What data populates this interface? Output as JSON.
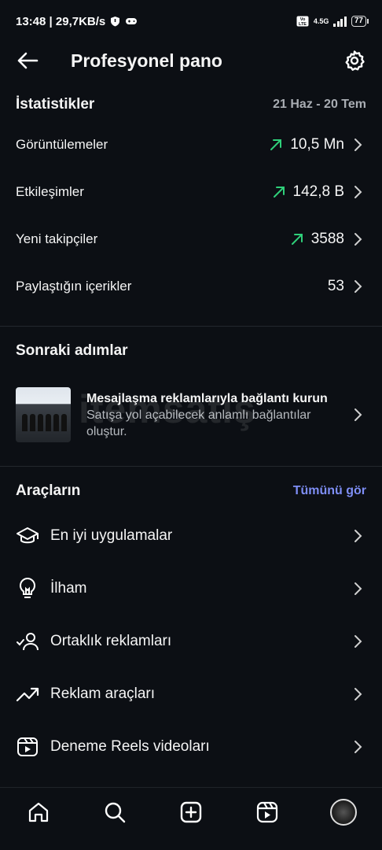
{
  "status_bar": {
    "time_speed": "13:48 | 29,7KB/s",
    "network": "4.5G",
    "battery": "77"
  },
  "header": {
    "title": "Profesyonel pano",
    "back_icon": "arrow-left-icon",
    "settings_icon": "gear-icon"
  },
  "statistics": {
    "title": "İstatistikler",
    "date_range": "21 Haz - 20 Tem",
    "rows": [
      {
        "label": "Görüntülemeler",
        "value": "10,5 Mn",
        "trend": "up"
      },
      {
        "label": "Etkileşimler",
        "value": "142,8 B",
        "trend": "up"
      },
      {
        "label": "Yeni takipçiler",
        "value": "3588",
        "trend": "up"
      },
      {
        "label": "Paylaştığın içerikler",
        "value": "53",
        "trend": ""
      }
    ]
  },
  "next_steps": {
    "title": "Sonraki adımlar",
    "card_title": "Mesajlaşma reklamlarıyla bağlantı kurun",
    "card_desc": "Satışa yol açabilecek anlamlı bağlantılar oluştur.",
    "watermark": "itemsatış"
  },
  "tools": {
    "title": "Araçların",
    "see_all": "Tümünü gör",
    "items": [
      {
        "label": "En iyi uygulamalar",
        "icon": "graduation-cap-icon"
      },
      {
        "label": "İlham",
        "icon": "lightbulb-icon"
      },
      {
        "label": "Ortaklık reklamları",
        "icon": "partner-check-icon"
      },
      {
        "label": "Reklam araçları",
        "icon": "trending-up-icon"
      },
      {
        "label": "Deneme Reels videoları",
        "icon": "reels-icon"
      }
    ]
  },
  "nav": {
    "items": [
      "home-icon",
      "search-icon",
      "create-icon",
      "reels-icon",
      "profile-avatar"
    ]
  },
  "colors": {
    "background": "#0c0f14",
    "trend_up": "#2fd07a",
    "link": "#7e8ef5"
  }
}
